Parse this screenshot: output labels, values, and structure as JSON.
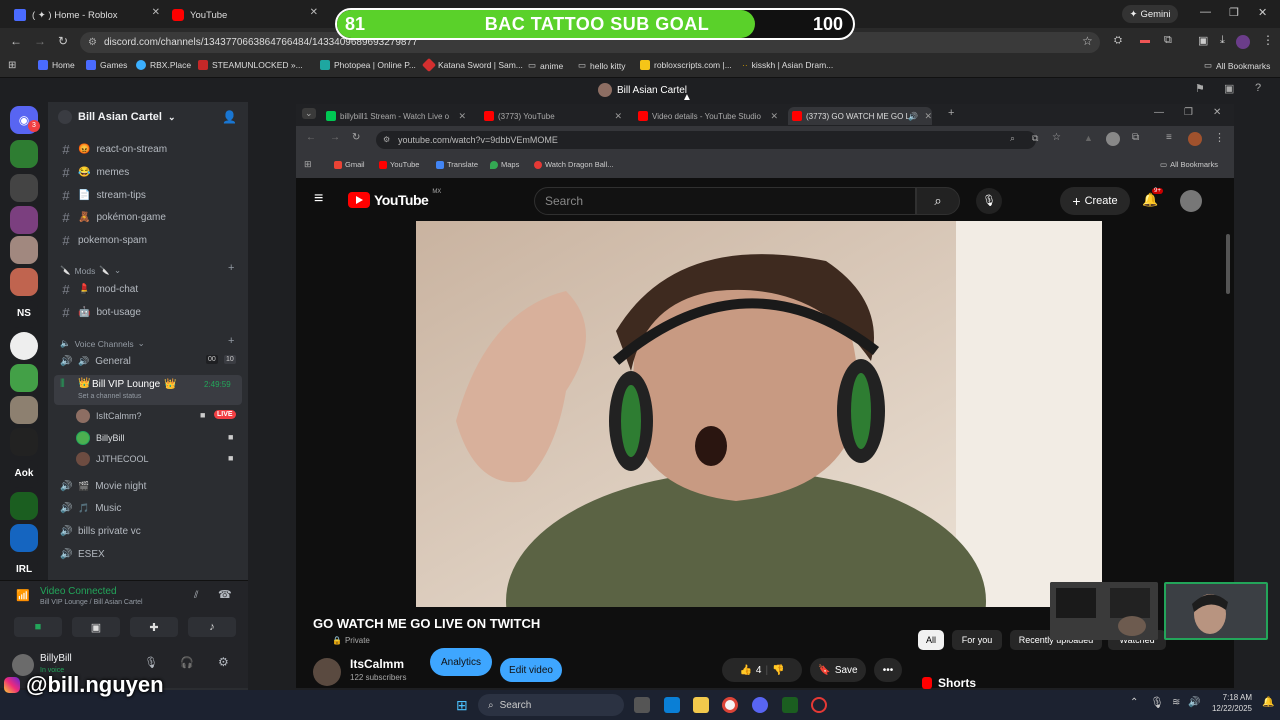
{
  "outer_browser": {
    "tabs": [
      {
        "label": "( ✦ ) Home - Roblox",
        "icon": "roblox-icon"
      },
      {
        "label": "YouTube",
        "icon": "youtube-icon"
      }
    ],
    "gemini_label": "Gemini",
    "url": "discord.com/channels/1343770663864766484/1433409689693279877",
    "bookmarks": [
      "Home",
      "Games",
      "RBX.Place",
      "STEAMUNLOCKED »...",
      "Photopea | Online P...",
      "Katana Sword | Sam...",
      "anime",
      "hello kitty",
      "robloxscripts.com |...",
      "kisskh | Asian Dram..."
    ],
    "all_bookmarks": "All Bookmarks"
  },
  "goal": {
    "current": "81",
    "title": "BAC TATTOO SUB GOAL",
    "target": "100",
    "progress": 0.81,
    "fill_color": "#5ad12a"
  },
  "discord": {
    "window_title": "Bill Asian Cartel",
    "server_name": "Bill Asian Cartel",
    "server_labels": [
      "NS",
      "Aok",
      "IRL"
    ],
    "notification_count": "3",
    "text_channels": [
      {
        "emoji": "😡",
        "name": "react-on-stream"
      },
      {
        "emoji": "😂",
        "name": "memes"
      },
      {
        "emoji": "📄",
        "name": "stream-tips"
      },
      {
        "emoji": "🧸",
        "name": "pokémon-game"
      },
      {
        "emoji": "",
        "name": "pokemon-spam"
      }
    ],
    "mods_category": "Mods",
    "mod_channels": [
      {
        "emoji": "💄",
        "name": "mod-chat"
      },
      {
        "emoji": "🤖",
        "name": "bot-usage"
      }
    ],
    "voice_category": "Voice Channels",
    "general": {
      "name": "General",
      "count_a": "00",
      "count_b": "10"
    },
    "vip_lounge": {
      "name": "Bill VIP Lounge",
      "timer": "2:49:59",
      "status": "Set a channel status"
    },
    "voice_users": [
      {
        "name": "IsItCalmm?",
        "live": "LIVE"
      },
      {
        "name": "BillyBill",
        "live": ""
      },
      {
        "name": "JJTHECOOL",
        "live": ""
      }
    ],
    "other_voice": [
      "Movie night",
      "Music",
      "bills private vc",
      "ESEX"
    ],
    "connection": {
      "status": "Video Connected",
      "location": "Bill VIP Lounge / Bill Asian Cartel"
    },
    "user": {
      "name": "BillyBill",
      "status": "In voice"
    }
  },
  "inner_browser": {
    "tabs": [
      {
        "label": "billybill1 Stream - Watch Live o",
        "icon": "twitch-icon",
        "color": "#00c853"
      },
      {
        "label": "(3773) YouTube",
        "icon": "youtube-icon",
        "color": "#ff0000"
      },
      {
        "label": "Video details - YouTube Studio",
        "icon": "youtube-icon",
        "color": "#ff0000"
      },
      {
        "label": "(3773) GO WATCH ME GO L",
        "icon": "youtube-icon",
        "color": "#ff0000"
      }
    ],
    "url": "youtube.com/watch?v=9dbbVEmMOME",
    "bookmarks": [
      "Gmail",
      "YouTube",
      "Translate",
      "Maps",
      "Watch Dragon Ball..."
    ],
    "all_bookmarks": "All Bookmarks"
  },
  "youtube": {
    "logo": "YouTube",
    "region": "MX",
    "search_placeholder": "Search",
    "create_label": "Create",
    "notifications": "9+",
    "video_title": "GO WATCH ME GO LIVE ON TWITCH",
    "privacy": "Private",
    "channel": "ItsCalmm",
    "subscribers": "122 subscribers",
    "analytics": "Analytics",
    "edit_video": "Edit video",
    "likes": "4",
    "save": "Save",
    "filters": [
      "All",
      "For you",
      "Recently uploaded",
      "Watched"
    ],
    "shorts": "Shorts"
  },
  "overlay": {
    "handle": "@bill.nguyen"
  },
  "taskbar": {
    "search": "Search",
    "time": "7:18 AM",
    "date": "12/22/2025"
  }
}
